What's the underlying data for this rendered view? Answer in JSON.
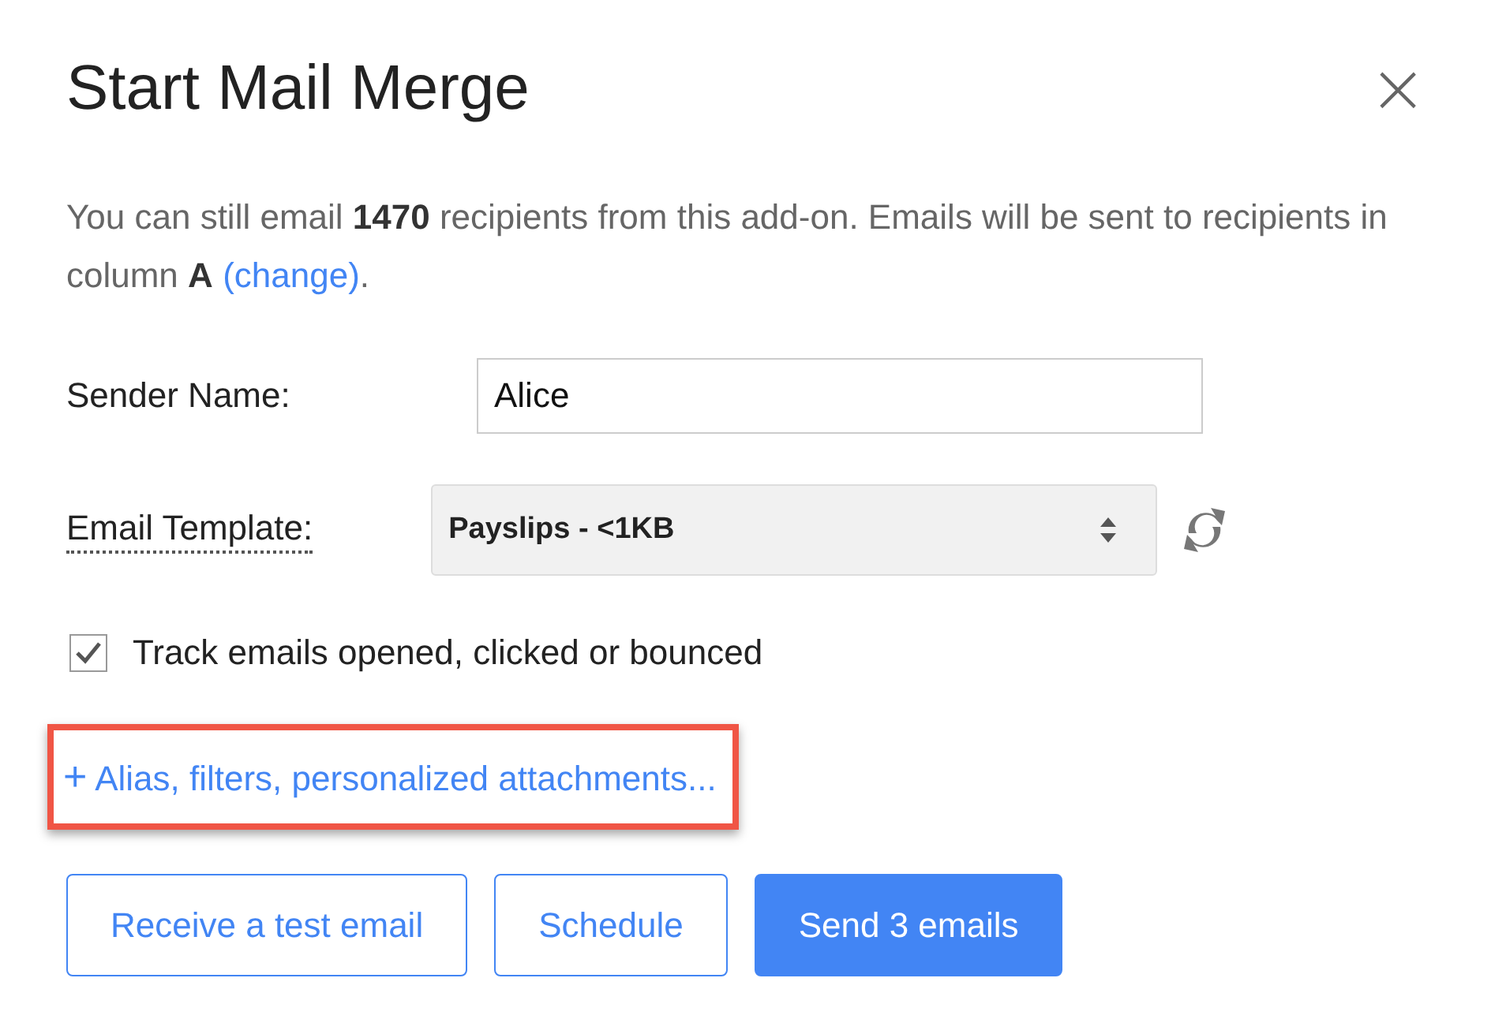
{
  "dialog": {
    "title": "Start Mail Merge",
    "close": "×"
  },
  "description": {
    "text": "You can still email **1470** recipients from this add-on. Emails will be sent to recipients in column **A**",
    "link": "(change)",
    "end": "."
  },
  "sender": {
    "label": "Sender Name:",
    "value": "Alice"
  },
  "template": {
    "label": "Email Template:",
    "value": "Payslips - <1KB"
  },
  "tracking": {
    "label": "Track emails opened, clicked or bounced",
    "checked": true
  },
  "options_link": {
    "icon": "+",
    "label": "Alias, filters, personalized attachments...",
    "highlighted": true
  },
  "buttons": [
    {
      "label": "Receive a test email",
      "kind": "outline"
    },
    {
      "label": "Schedule",
      "kind": "outline"
    },
    {
      "label": "Send 3 emails",
      "kind": "primary"
    }
  ]
}
